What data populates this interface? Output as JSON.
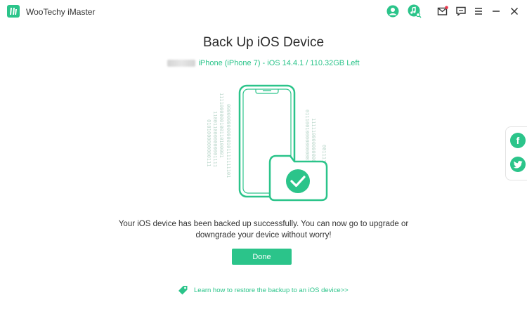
{
  "app": {
    "title": "WooTechy iMaster",
    "logo_text": "i"
  },
  "titlebar_icons": [
    {
      "name": "account-icon"
    },
    {
      "name": "music-search-icon"
    },
    {
      "name": "mail-icon"
    },
    {
      "name": "feedback-icon"
    },
    {
      "name": "menu-icon"
    },
    {
      "name": "minimize-icon"
    },
    {
      "name": "close-icon"
    }
  ],
  "main": {
    "title": "Back Up iOS Device",
    "device_info": "iPhone (iPhone 7) - iOS 14.4.1 / 110.32GB Left",
    "message_line1": "Your iOS device has been backed up successfully. You can now go to upgrade or",
    "message_line2": "downgrade your device without worry!",
    "done_label": "Done",
    "learn_link": "Learn how to restore the backup to an iOS device>>"
  },
  "binary": {
    "col1": "0101000000000111",
    "col2": "1100110000000001111",
    "col3": "1111000000100110100001",
    "col4": "0000000000000101111111101",
    "col5": "0111001000000000011",
    "col6": "11111000000000000000",
    "col7": "0011111111011"
  },
  "social": {
    "facebook": "f",
    "twitter": "twitter-icon"
  },
  "colors": {
    "accent": "#2bc48a",
    "mail_dot": "#e8384f"
  }
}
